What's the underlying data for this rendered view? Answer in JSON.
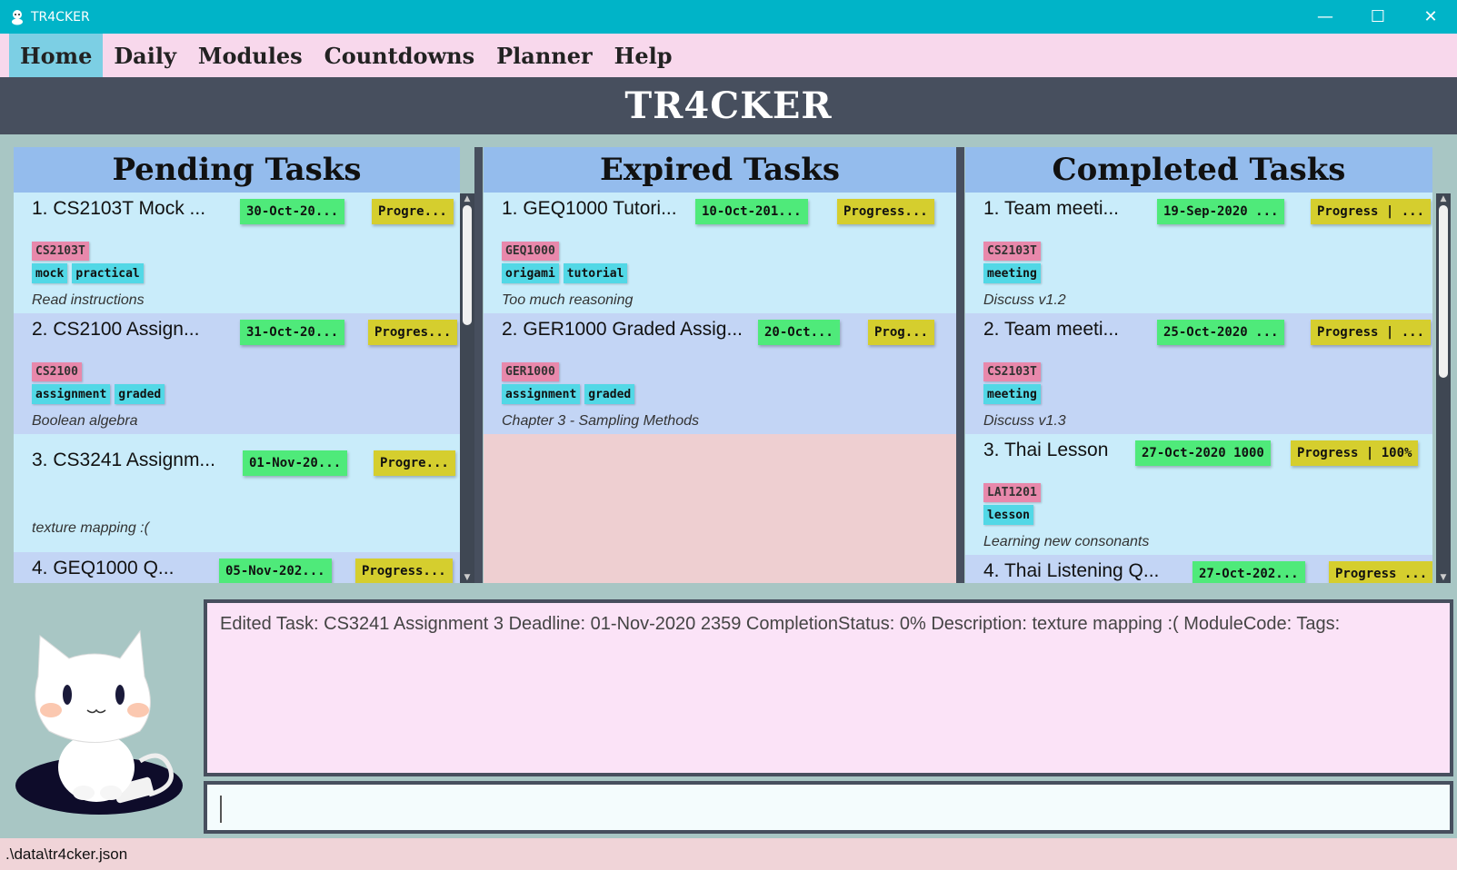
{
  "window": {
    "title": "TR4CKER",
    "minimize": "—",
    "maximize": "☐",
    "close": "✕"
  },
  "menu": {
    "items": [
      "Home",
      "Daily",
      "Modules",
      "Countdowns",
      "Planner",
      "Help"
    ]
  },
  "banner": {
    "title": "TR4CKER"
  },
  "pending": {
    "title": "Pending Tasks",
    "tasks": [
      {
        "name": "1.  CS2103T Mock ...",
        "date": "30-Oct-20...",
        "progress": "Progre...",
        "module": "CS2103T",
        "tags": [
          "mock",
          "practical"
        ],
        "desc": "Read instructions"
      },
      {
        "name": "2.  CS2100 Assign...",
        "date": "31-Oct-20...",
        "progress": "Progres...",
        "module": "CS2100",
        "tags": [
          "assignment",
          "graded"
        ],
        "desc": "Boolean algebra"
      },
      {
        "name": "3.  CS3241 Assignm...",
        "date": "01-Nov-20...",
        "progress": "Progre...",
        "module": "",
        "tags": [],
        "desc": "texture mapping :("
      },
      {
        "name": "4.  GEQ1000 Q...",
        "date": "05-Nov-202...",
        "progress": "Progress...",
        "module": "",
        "tags": [],
        "desc": ""
      }
    ]
  },
  "expired": {
    "title": "Expired Tasks",
    "tasks": [
      {
        "name": "1.  GEQ1000 Tutori...",
        "date": "10-Oct-201...",
        "progress": "Progress...",
        "module": "GEQ1000",
        "tags": [
          "origami",
          "tutorial"
        ],
        "desc": "Too much reasoning"
      },
      {
        "name": "2.  GER1000 Graded Assig...",
        "date": "20-Oct...",
        "progress": "Prog...",
        "module": "GER1000",
        "tags": [
          "assignment",
          "graded"
        ],
        "desc": "Chapter 3 - Sampling Methods"
      }
    ]
  },
  "completed": {
    "title": "Completed Tasks",
    "tasks": [
      {
        "name": "1.  Team meeti...",
        "date": "19-Sep-2020 ...",
        "progress": "Progress | ...",
        "module": "CS2103T",
        "tags": [
          "meeting"
        ],
        "desc": "Discuss v1.2"
      },
      {
        "name": "2.  Team meeti...",
        "date": "25-Oct-2020 ...",
        "progress": "Progress | ...",
        "module": "CS2103T",
        "tags": [
          "meeting"
        ],
        "desc": "Discuss v1.3"
      },
      {
        "name": "3.  Thai Lesson",
        "date": "27-Oct-2020 1000",
        "progress": "Progress | 100%",
        "module": "LAT1201",
        "tags": [
          "lesson"
        ],
        "desc": "Learning new consonants"
      },
      {
        "name": "4.  Thai Listening Q...",
        "date": "27-Oct-202...",
        "progress": "Progress ...",
        "module": "",
        "tags": [],
        "desc": ""
      }
    ]
  },
  "result": {
    "text": "Edited Task: CS3241 Assignment 3 Deadline: 01-Nov-2020 2359 CompletionStatus: 0% Description: texture mapping :( ModuleCode:  Tags:"
  },
  "command": {
    "value": ""
  },
  "status": {
    "path": ".\\data\\tr4cker.json"
  },
  "colors": {
    "accent": "#00b4c8",
    "menu_bg": "#f8d8ec",
    "date": "#4fea7a",
    "progress": "#d5ce2e",
    "module": "#e888ab",
    "tag": "#52d8e6"
  }
}
